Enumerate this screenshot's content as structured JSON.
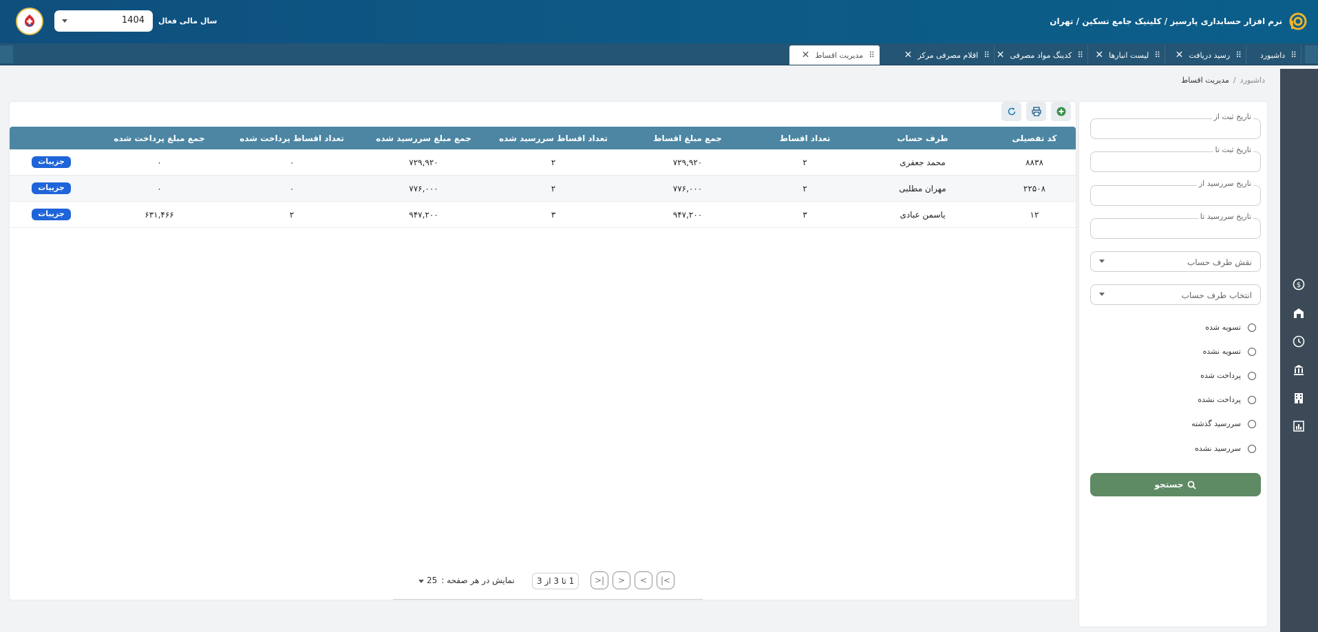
{
  "header": {
    "app_title": "نرم افزار حسابداری پارسیز / کلینیک جامع تسکین / تهران",
    "fiscal_year_label": "سال مالی فعال",
    "fiscal_year_value": "1404"
  },
  "tabs": [
    {
      "label": "داشبورد"
    },
    {
      "label": "رسید دریافت"
    },
    {
      "label": "لیست انبارها"
    },
    {
      "label": "کدینگ مواد مصرفی"
    },
    {
      "label": "اقلام مصرفی مرکز"
    },
    {
      "label": "مدیریت اقساط"
    }
  ],
  "breadcrumb": {
    "home": "داشبورد",
    "separator": "/",
    "current": "مدیریت اقساط"
  },
  "filters": {
    "reg_date_from": "تاریخ ثبت از",
    "reg_date_to": "تاریخ ثبت تا",
    "due_date_from": "تاریخ سررسید از",
    "due_date_to": "تاریخ سررسید تا",
    "party_role": "نقش طرف حساب",
    "party_select": "انتخاب طرف حساب",
    "radios": [
      "تسویه شده",
      "تسویه نشده",
      "پرداخت شده",
      "پرداخت نشده",
      "سررسید گذشته",
      "سررسید نشده"
    ],
    "search_label": "جستجو"
  },
  "table": {
    "columns": [
      "کد تفصیلی",
      "طرف حساب",
      "تعداد اقساط",
      "جمع مبلغ اقساط",
      "تعداد اقساط سررسید شده",
      "جمع مبلغ سررسید شده",
      "تعداد اقساط پرداخت شده",
      "جمع مبلغ پرداخت شده",
      ""
    ],
    "details_label": "جزییات",
    "rows": [
      [
        "۸۸۳۸",
        "محمد جعفری",
        "۲",
        "۷۲۹,۹۲۰",
        "۲",
        "۷۲۹,۹۲۰",
        "۰",
        "۰"
      ],
      [
        "۲۲۵۰۸",
        "مهران مطلبی",
        "۲",
        "۷۷۶,۰۰۰",
        "۲",
        "۷۷۶,۰۰۰",
        "۰",
        "۰"
      ],
      [
        "۱۲",
        "یاسمن عبادی",
        "۳",
        "۹۴۷,۲۰۰",
        "۳",
        "۹۴۷,۲۰۰",
        "۲",
        "۶۳۱,۴۶۶"
      ]
    ]
  },
  "pagination": {
    "page_info": "1 تا 3 از 3",
    "per_page_label": "نمایش در هر صفحه :",
    "per_page_value": "25"
  },
  "colors": {
    "header": "#0d5a86",
    "tabbar": "#245574",
    "table_head": "#4c86a3",
    "search_button": "#5e8a64",
    "details_button": "#1f64d8",
    "rail": "#3b4a56"
  },
  "icons": [
    "app-logo-icon",
    "org-logo-icon",
    "drag-handle-icon",
    "close-icon",
    "add-icon",
    "print-icon",
    "refresh-icon",
    "search-icon",
    "first-page-icon",
    "prev-page-icon",
    "next-page-icon",
    "last-page-icon",
    "dollar-icon",
    "warehouse-icon",
    "history-icon",
    "bank-icon",
    "building-icon",
    "report-icon"
  ]
}
